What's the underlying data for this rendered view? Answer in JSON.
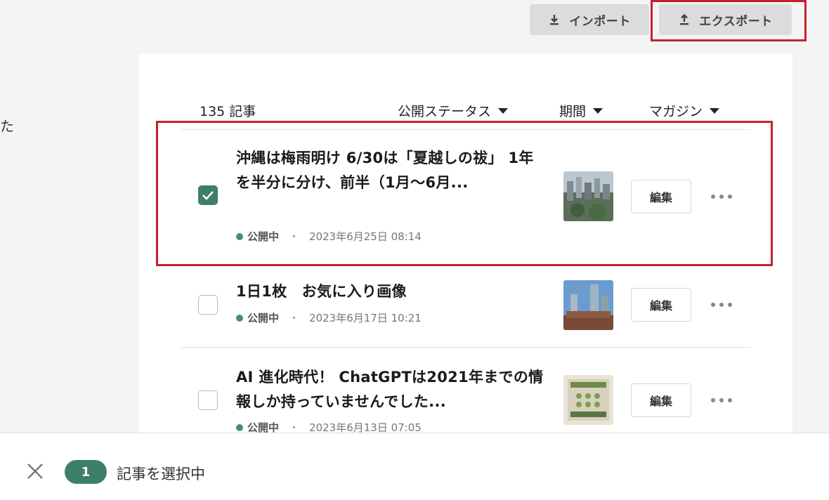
{
  "sidebar": {
    "fragment_text": "た"
  },
  "toolbar": {
    "import_label": "インポート",
    "export_label": "エクスポート"
  },
  "list": {
    "count_label": "135 記事",
    "filters": {
      "status": "公開ステータス",
      "period": "期間",
      "magazine": "マガジン"
    },
    "articles": [
      {
        "title": "沖縄は梅雨明け 6/30は「夏越しの祓」 1年を半分に分け、前半（1月〜6月...",
        "status": "公開中",
        "date": "2023年6月25日 08:14",
        "edit_label": "編集",
        "checked": true
      },
      {
        "title": "1日1枚　お気に入り画像",
        "status": "公開中",
        "date": "2023年6月17日 10:21",
        "edit_label": "編集",
        "checked": false
      },
      {
        "title": "AI 進化時代！ ChatGPTは2021年までの情報しか持っていませんでした...",
        "status": "公開中",
        "date": "2023年6月13日 07:05",
        "edit_label": "編集",
        "checked": false
      }
    ]
  },
  "selection_bar": {
    "count": "1",
    "label": "記事を選択中"
  },
  "colors": {
    "accent": "#3e7f6a",
    "highlight": "#c8202b",
    "status_dot": "#4c8a72"
  }
}
